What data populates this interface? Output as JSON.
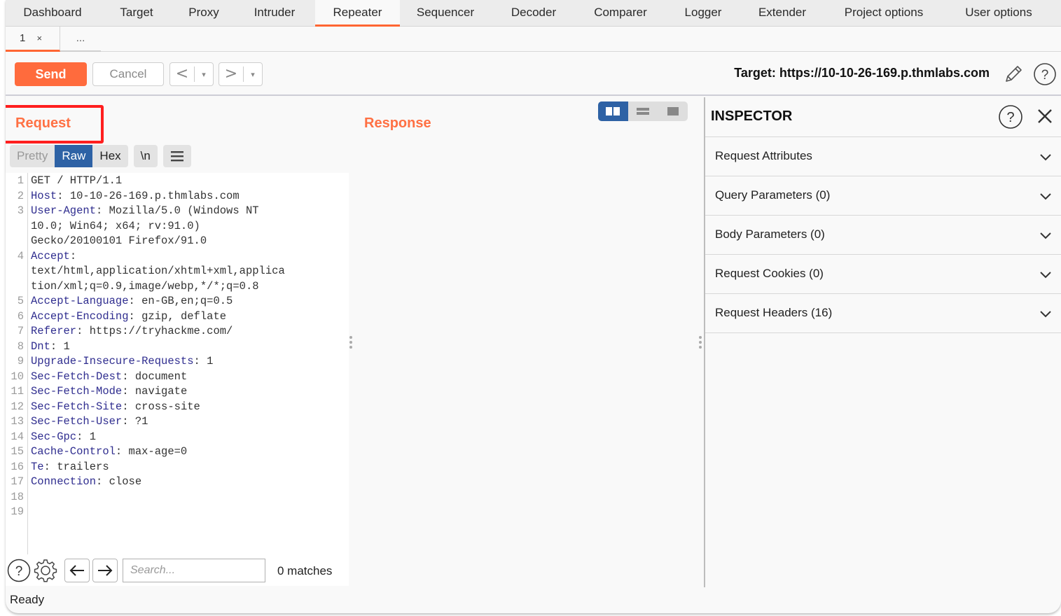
{
  "main_tabs": [
    {
      "label": "Dashboard",
      "active": false
    },
    {
      "label": "Target",
      "active": false
    },
    {
      "label": "Proxy",
      "active": false
    },
    {
      "label": "Intruder",
      "active": false
    },
    {
      "label": "Repeater",
      "active": true
    },
    {
      "label": "Sequencer",
      "active": false
    },
    {
      "label": "Decoder",
      "active": false
    },
    {
      "label": "Comparer",
      "active": false
    },
    {
      "label": "Logger",
      "active": false
    },
    {
      "label": "Extender",
      "active": false
    },
    {
      "label": "Project options",
      "active": false
    },
    {
      "label": "User options",
      "active": false
    }
  ],
  "sub_tabs": {
    "tab1_label": "1",
    "tab1_close": "×",
    "more_label": "..."
  },
  "toolbar": {
    "send_label": "Send",
    "cancel_label": "Cancel",
    "back_arrow": "<",
    "forward_arrow": ">",
    "dropdown_glyph": "▾",
    "target_label": "Target: https://10-10-26-169.p.thmlabs.com"
  },
  "request": {
    "title": "Request",
    "view_tabs": {
      "pretty": "Pretty",
      "raw": "Raw",
      "hex": "Hex",
      "newline": "\\n",
      "active": "Raw"
    },
    "lines": [
      {
        "num": "1",
        "name": "",
        "value": "GET / HTTP/1.1"
      },
      {
        "num": "2",
        "name": "Host",
        "value": ": 10-10-26-169.p.thmlabs.com"
      },
      {
        "num": "3",
        "name": "User-Agent",
        "value": ": Mozilla/5.0 (Windows NT"
      },
      {
        "num": "",
        "name": "",
        "value": "10.0; Win64; x64; rv:91.0)"
      },
      {
        "num": "",
        "name": "",
        "value": "Gecko/20100101 Firefox/91.0"
      },
      {
        "num": "4",
        "name": "Accept",
        "value": ":"
      },
      {
        "num": "",
        "name": "",
        "value": "text/html,application/xhtml+xml,applica"
      },
      {
        "num": "",
        "name": "",
        "value": "tion/xml;q=0.9,image/webp,*/*;q=0.8"
      },
      {
        "num": "5",
        "name": "Accept-Language",
        "value": ": en-GB,en;q=0.5"
      },
      {
        "num": "6",
        "name": "Accept-Encoding",
        "value": ": gzip, deflate"
      },
      {
        "num": "7",
        "name": "Referer",
        "value": ": https://tryhackme.com/"
      },
      {
        "num": "8",
        "name": "Dnt",
        "value": ": 1"
      },
      {
        "num": "9",
        "name": "Upgrade-Insecure-Requests",
        "value": ": 1"
      },
      {
        "num": "10",
        "name": "Sec-Fetch-Dest",
        "value": ": document"
      },
      {
        "num": "11",
        "name": "Sec-Fetch-Mode",
        "value": ": navigate"
      },
      {
        "num": "12",
        "name": "Sec-Fetch-Site",
        "value": ": cross-site"
      },
      {
        "num": "13",
        "name": "Sec-Fetch-User",
        "value": ": ?1"
      },
      {
        "num": "14",
        "name": "Sec-Gpc",
        "value": ": 1"
      },
      {
        "num": "15",
        "name": "Cache-Control",
        "value": ": max-age=0"
      },
      {
        "num": "16",
        "name": "Te",
        "value": ": trailers"
      },
      {
        "num": "17",
        "name": "Connection",
        "value": ": close"
      },
      {
        "num": "18",
        "name": "",
        "value": ""
      },
      {
        "num": "19",
        "name": "",
        "value": ""
      }
    ],
    "search": {
      "placeholder": "Search...",
      "value": "",
      "matches": "0 matches"
    }
  },
  "response": {
    "title": "Response",
    "layout_active": "side-by-side"
  },
  "inspector": {
    "title": "INSPECTOR",
    "sections": [
      {
        "label": "Request Attributes"
      },
      {
        "label": "Query Parameters (0)"
      },
      {
        "label": "Body Parameters (0)"
      },
      {
        "label": "Request Cookies (0)"
      },
      {
        "label": "Request Headers (16)"
      }
    ]
  },
  "status_bar": {
    "text": "Ready"
  },
  "colors": {
    "accent": "#ff6b3d",
    "title_orange": "#ff7043",
    "active_blue": "#2e62a5",
    "header_name": "#2f2d8f",
    "highlight_box": "#ff1f1f"
  }
}
